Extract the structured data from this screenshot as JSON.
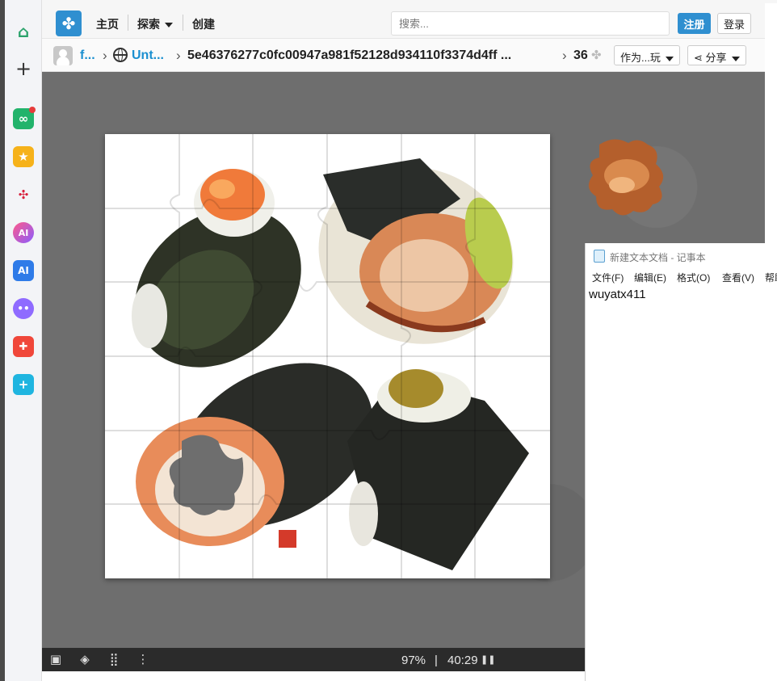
{
  "nav": {
    "home": "主页",
    "explore": "探索",
    "create": "创建",
    "search_placeholder": "搜索...",
    "register": "注册",
    "login": "登录"
  },
  "breadcrumb": {
    "user": "f...",
    "collection": "Unt...",
    "puzzle_id": "5e46376277c0fc00947a981f52128d934110f3374d4ff ...",
    "pieces": "36",
    "play_as": "作为...玩",
    "share": "分享"
  },
  "status": {
    "progress": "97%",
    "separator": "|",
    "timer": "40:29"
  },
  "notepad": {
    "title": "新建文本文档 - 记事本",
    "menu": [
      "文件(F)",
      "编辑(E)",
      "格式(O)",
      "查看(V)",
      "帮助"
    ],
    "content": "wuyatx411"
  },
  "colors": {
    "accent": "#2f8fd0",
    "link": "#1a8fd0",
    "table_bg": "#6e6e6e"
  },
  "icons": {
    "sidebar": [
      "home-icon",
      "plus-icon",
      "link-app-icon",
      "star-app-icon",
      "graph-app-icon",
      "ai-app-icon",
      "ai-square-app-icon",
      "chat-bot-app-icon",
      "gamepad-app-icon",
      "plus-app-icon"
    ],
    "bottombar": [
      "image-preview-icon",
      "ghost-icon",
      "grid-icon",
      "more-icon",
      "pause-icon"
    ]
  }
}
